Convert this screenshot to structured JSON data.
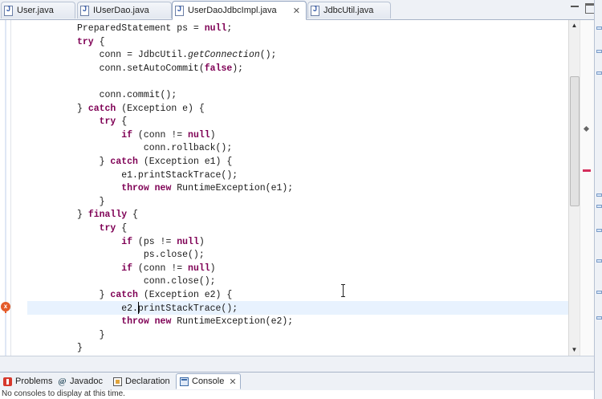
{
  "editor_tabs": [
    {
      "label": "User.java",
      "active": false
    },
    {
      "label": "IUserDao.java",
      "active": false
    },
    {
      "label": "UserDaoJdbcImpl.java",
      "active": true
    },
    {
      "label": "JdbcUtil.java",
      "active": false
    }
  ],
  "code_lines": [
    [
      {
        "t": "PreparedStatement ps = "
      },
      {
        "t": "null",
        "k": "kw"
      },
      {
        "t": ";"
      }
    ],
    [
      {
        "t": "try",
        "k": "kw"
      },
      {
        "t": " {"
      }
    ],
    [
      {
        "t": "    conn = JdbcUtil."
      },
      {
        "t": "getConnection",
        "k": "it"
      },
      {
        "t": "();"
      }
    ],
    [
      {
        "t": "    conn.setAutoCommit("
      },
      {
        "t": "false",
        "k": "kw"
      },
      {
        "t": ");"
      }
    ],
    [
      {
        "t": ""
      }
    ],
    [
      {
        "t": "    conn.commit();"
      }
    ],
    [
      {
        "t": "} "
      },
      {
        "t": "catch",
        "k": "kw"
      },
      {
        "t": " (Exception e) {"
      }
    ],
    [
      {
        "t": "    "
      },
      {
        "t": "try",
        "k": "kw"
      },
      {
        "t": " {"
      }
    ],
    [
      {
        "t": "        "
      },
      {
        "t": "if",
        "k": "kw"
      },
      {
        "t": " (conn != "
      },
      {
        "t": "null",
        "k": "kw"
      },
      {
        "t": ")"
      }
    ],
    [
      {
        "t": "            conn.rollback();"
      }
    ],
    [
      {
        "t": "    } "
      },
      {
        "t": "catch",
        "k": "kw"
      },
      {
        "t": " (Exception e1) {"
      }
    ],
    [
      {
        "t": "        e1.printStackTrace();"
      }
    ],
    [
      {
        "t": "        "
      },
      {
        "t": "throw",
        "k": "kw"
      },
      {
        "t": " "
      },
      {
        "t": "new",
        "k": "kw"
      },
      {
        "t": " RuntimeException(e1);"
      }
    ],
    [
      {
        "t": "    }"
      }
    ],
    [
      {
        "t": "} "
      },
      {
        "t": "finally",
        "k": "kw"
      },
      {
        "t": " {"
      }
    ],
    [
      {
        "t": "    "
      },
      {
        "t": "try",
        "k": "kw"
      },
      {
        "t": " {"
      }
    ],
    [
      {
        "t": "        "
      },
      {
        "t": "if",
        "k": "kw"
      },
      {
        "t": " (ps != "
      },
      {
        "t": "null",
        "k": "kw"
      },
      {
        "t": ")"
      }
    ],
    [
      {
        "t": "            ps.close();"
      }
    ],
    [
      {
        "t": "        "
      },
      {
        "t": "if",
        "k": "kw"
      },
      {
        "t": " (conn != "
      },
      {
        "t": "null",
        "k": "kw"
      },
      {
        "t": ")"
      }
    ],
    [
      {
        "t": "            conn.close();"
      }
    ],
    [
      {
        "t": "    } "
      },
      {
        "t": "catch",
        "k": "kw"
      },
      {
        "t": " (Exception e2) {"
      }
    ],
    [
      {
        "t": "        e2.printStackTrace();"
      }
    ],
    [
      {
        "t": "        "
      },
      {
        "t": "throw",
        "k": "kw"
      },
      {
        "t": " "
      },
      {
        "t": "new",
        "k": "kw"
      },
      {
        "t": " RuntimeException(e2);"
      }
    ],
    [
      {
        "t": "    }"
      }
    ],
    [
      {
        "t": "}"
      }
    ]
  ],
  "bottom_tabs": [
    {
      "label": "Problems",
      "icon": "problems-icon",
      "active": false
    },
    {
      "label": "Javadoc",
      "icon": "javadoc-icon",
      "active": false
    },
    {
      "label": "Declaration",
      "icon": "declaration-icon",
      "active": false
    },
    {
      "label": "Console",
      "icon": "console-icon",
      "active": true
    }
  ],
  "console": {
    "message": "No consoles to display at this time."
  },
  "colors": {
    "keyword": "#7f0055",
    "current_line": "#e8f2fe",
    "error_marker": "#d42e5c"
  }
}
